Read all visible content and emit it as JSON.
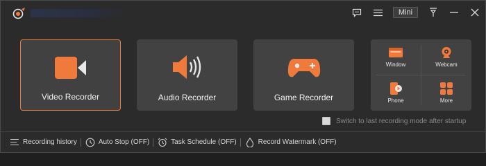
{
  "titlebar": {
    "mini_label": "Mini",
    "icons": [
      "feedback-icon",
      "menu-icon",
      "pin-icon",
      "minimize-icon",
      "close-icon"
    ]
  },
  "modes": {
    "video": {
      "label": "Video Recorder",
      "icon": "video-camera-icon"
    },
    "audio": {
      "label": "Audio Recorder",
      "icon": "speaker-icon"
    },
    "game": {
      "label": "Game Recorder",
      "icon": "gamepad-icon"
    },
    "more_panel": {
      "window": "Window",
      "webcam": "Webcam",
      "phone": "Phone",
      "more": "More"
    }
  },
  "switch_option": {
    "label": "Switch to last recording mode after startup",
    "checked": false
  },
  "footer": {
    "recording_history": "Recording history",
    "auto_stop": "Auto Stop (OFF)",
    "task_schedule": "Task Schedule (OFF)",
    "record_watermark": "Record Watermark (OFF)"
  },
  "colors": {
    "accent": "#f07a3b",
    "background": "#2b2b2b",
    "tile": "#424242"
  }
}
